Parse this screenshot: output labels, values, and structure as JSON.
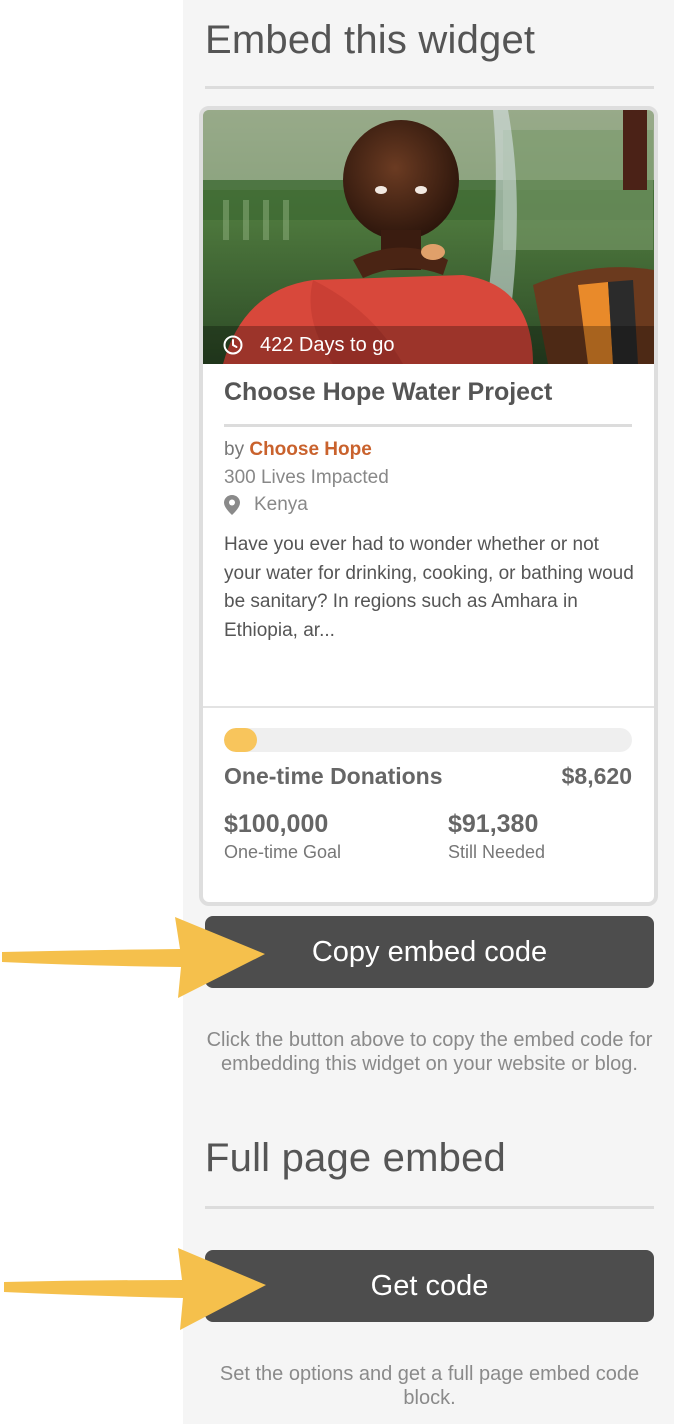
{
  "embed_section": {
    "title": "Embed this widget"
  },
  "widget": {
    "days_to_go": "422 Days to go",
    "title": "Choose Hope Water Project",
    "by_prefix": "by",
    "organization": "Choose Hope",
    "lives_impacted": "300 Lives Impacted",
    "location": "Kenya",
    "description": "Have you ever had to wonder whether or not your water for drinking, cooking, or bathing woud be sanitary? In regions such as Amhara in Ethiopia, ar...",
    "progress_fraction": 0.08,
    "donations_label": "One-time Donations",
    "donations_value": "$8,620",
    "goal_value": "$100,000",
    "goal_label": "One-time Goal",
    "needed_value": "$91,380",
    "needed_label": "Still Needed"
  },
  "copy_button": {
    "label": "Copy embed code"
  },
  "copy_help": "Click the button above to copy the embed code for embedding this widget on your website or blog.",
  "full_page_section": {
    "title": "Full page embed"
  },
  "get_code_button": {
    "label": "Get code"
  },
  "full_page_help": "Set the options and get a full page embed code block.",
  "colors": {
    "accent_org": "#c9622d",
    "progress": "#f8c55c",
    "button_bg": "#4d4d4d",
    "arrow": "#f5c04c"
  },
  "icons": {
    "days": "clock-icon",
    "location": "map-pin-icon",
    "annotation": "arrow-annotation"
  }
}
